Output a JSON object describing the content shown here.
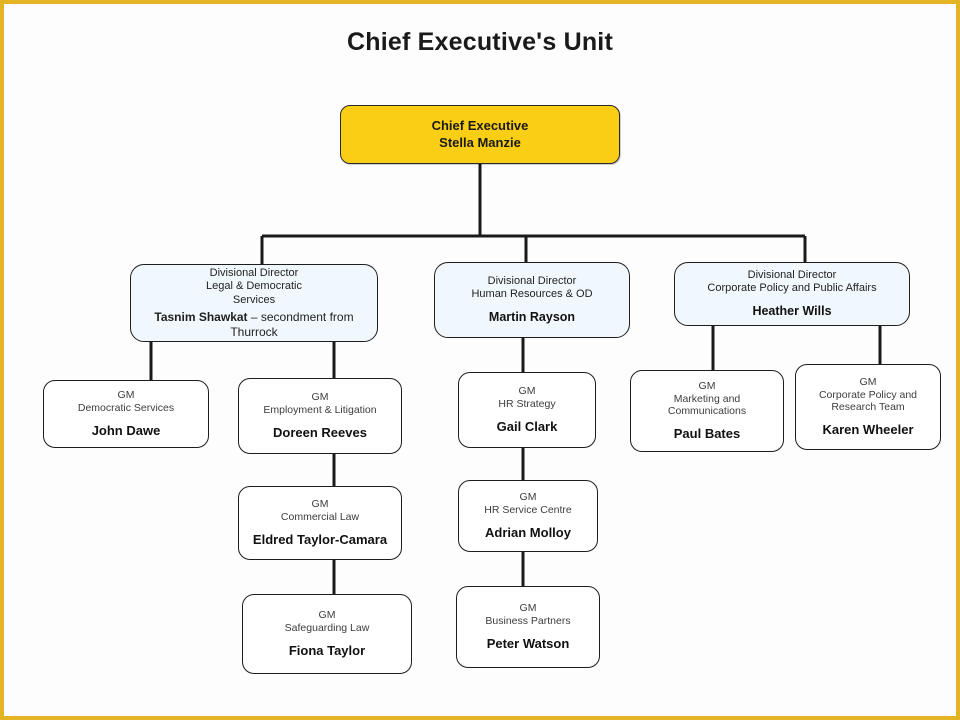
{
  "page": {
    "title": "Chief Executive's Unit",
    "border_color": "#e2b426",
    "background": "#fdfdfd",
    "watermark": ""
  },
  "colors": {
    "root_fill": "#fbce16",
    "director_fill": "#f1f8fd",
    "gm_fill": "#ffffff",
    "line": "#1a1a1a",
    "border": "#1d1d1d"
  },
  "chart_data": {
    "type": "orgchart",
    "title": "Chief Executive's Unit",
    "nodes": [
      {
        "id": "ceo",
        "level": 0,
        "role": "Chief Executive",
        "person": "Stella Manzie",
        "fill": "#fbce16",
        "parent": null
      },
      {
        "id": "dd-legal",
        "level": 1,
        "role": "Divisional Director\nLegal & Democratic\nServices",
        "person": "Tasnim Shawkat – secondment from Thurrock",
        "person_bold_part": "Tasnim Shawkat",
        "person_rest": " – secondment from Thurrock",
        "fill": "#f1f8fd",
        "parent": "ceo"
      },
      {
        "id": "dd-hr",
        "level": 1,
        "role": "Divisional Director\nHuman Resources & OD",
        "person": "Martin Rayson",
        "fill": "#f1f8fd",
        "parent": "ceo"
      },
      {
        "id": "dd-policy",
        "level": 1,
        "role": "Divisional Director\nCorporate Policy and Public Affairs",
        "person": "Heather Wills",
        "fill": "#f1f8fd",
        "parent": "ceo"
      },
      {
        "id": "gm-democratic",
        "level": 2,
        "role": "GM\nDemocratic Services",
        "person": "John Dawe",
        "fill": "#ffffff",
        "parent": "dd-legal"
      },
      {
        "id": "gm-employment",
        "level": 2,
        "role": "GM\nEmployment & Litigation",
        "person": "Doreen Reeves",
        "fill": "#ffffff",
        "parent": "dd-legal"
      },
      {
        "id": "gm-commercial",
        "level": 3,
        "role": "GM\nCommercial Law",
        "person": "Eldred Taylor-Camara",
        "fill": "#ffffff",
        "parent": "gm-employment"
      },
      {
        "id": "gm-safeguarding",
        "level": 4,
        "role": "GM\nSafeguarding Law",
        "person": "Fiona Taylor",
        "fill": "#ffffff",
        "parent": "gm-commercial"
      },
      {
        "id": "gm-hrstrategy",
        "level": 2,
        "role": "GM\nHR Strategy",
        "person": "Gail Clark",
        "fill": "#ffffff",
        "parent": "dd-hr"
      },
      {
        "id": "gm-hrservice",
        "level": 3,
        "role": "GM\nHR Service Centre",
        "person": "Adrian Molloy",
        "fill": "#ffffff",
        "parent": "gm-hrstrategy"
      },
      {
        "id": "gm-businesspartners",
        "level": 4,
        "role": "GM\nBusiness Partners",
        "person": "Peter Watson",
        "fill": "#ffffff",
        "parent": "gm-hrservice"
      },
      {
        "id": "gm-marketing",
        "level": 2,
        "role": "GM\nMarketing and Communications",
        "person": "Paul Bates",
        "fill": "#ffffff",
        "parent": "dd-policy"
      },
      {
        "id": "gm-research",
        "level": 2,
        "role": "GM\nCorporate Policy and Research Team",
        "person": "Karen Wheeler",
        "fill": "#ffffff",
        "parent": "dd-policy"
      }
    ]
  }
}
